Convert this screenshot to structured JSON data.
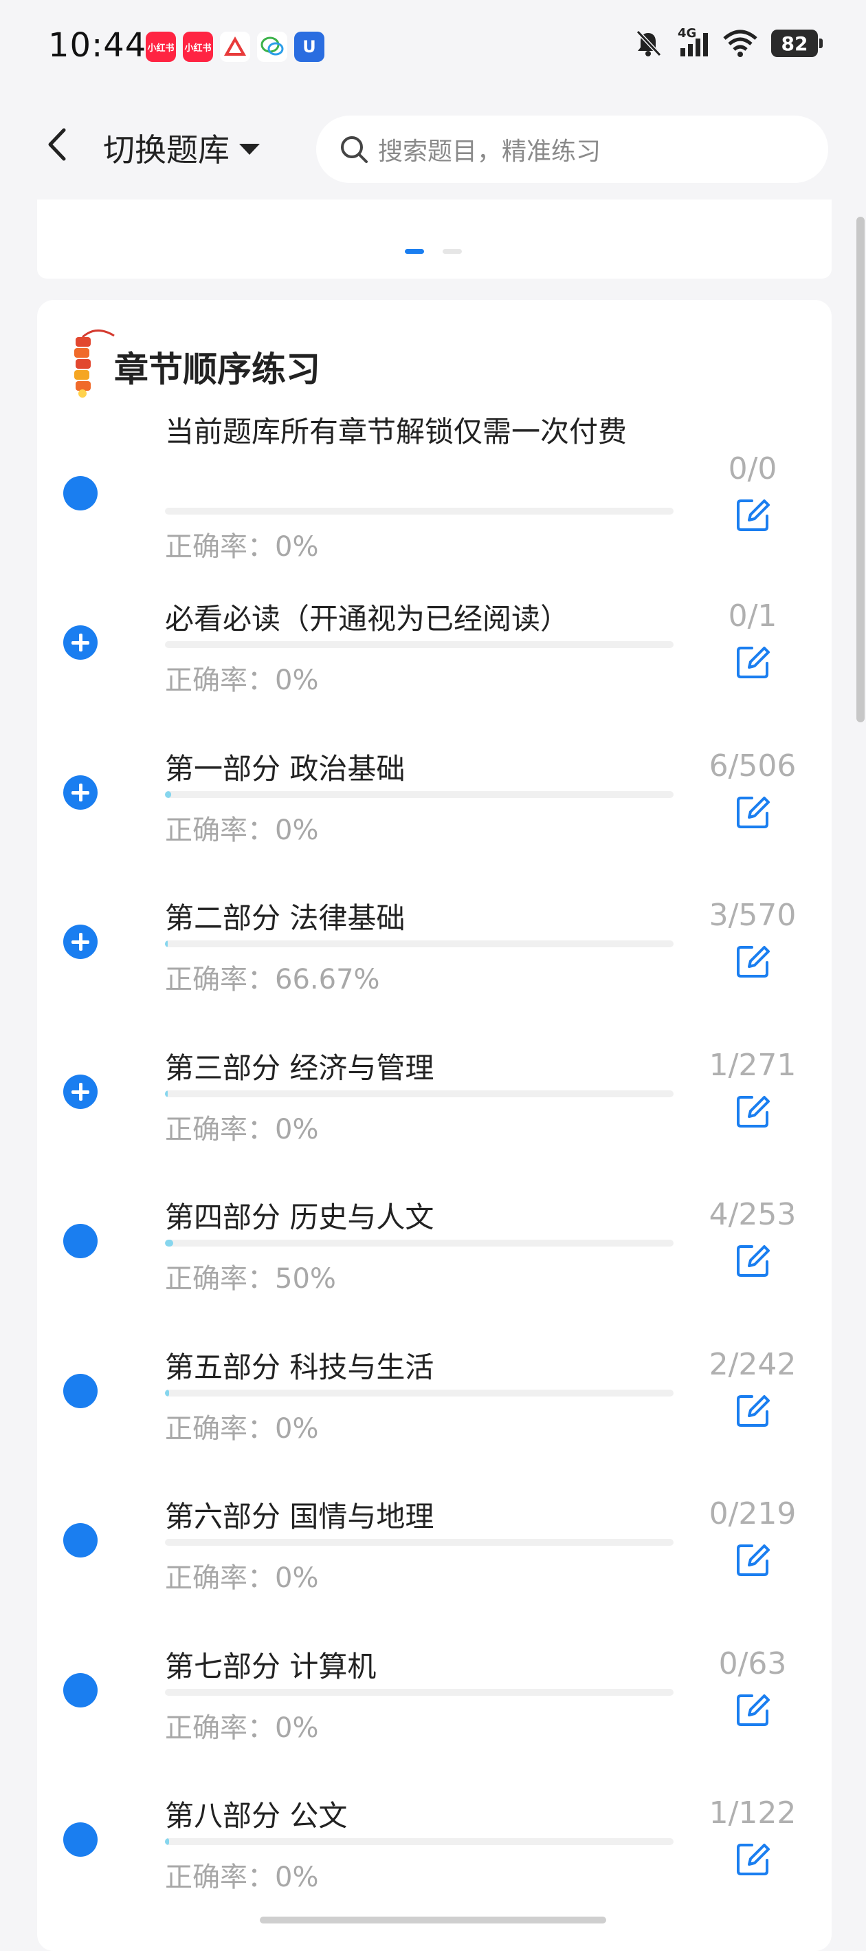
{
  "status_bar": {
    "time": "10:44",
    "battery": "82",
    "network": "4G",
    "apps": [
      {
        "label": "小红书",
        "color": "#ff2442"
      },
      {
        "label": "小红书",
        "color": "#ff2442"
      },
      {
        "label": "",
        "color": "#ffffff"
      },
      {
        "label": "",
        "color": "#ffffff"
      },
      {
        "label": "U",
        "color": "#2a6de0"
      }
    ]
  },
  "header": {
    "switch_label": "切换题库",
    "search_placeholder": "搜索题目，精准练习"
  },
  "section": {
    "title": "章节顺序练习"
  },
  "accuracy_prefix": "正确率：",
  "rows": [
    {
      "title": "当前题库所有章节解锁仅需一次付费",
      "accuracy": "0%",
      "count": "0/0",
      "icon": "dot",
      "progress": 0
    },
    {
      "title": "必看必读（开通视为已经阅读）",
      "accuracy": "0%",
      "count": "0/1",
      "icon": "plus",
      "progress": 0
    },
    {
      "title": "第一部分 政治基础",
      "accuracy": "0%",
      "count": "6/506",
      "icon": "plus",
      "progress": 0.012
    },
    {
      "title": "第二部分 法律基础",
      "accuracy": "66.67%",
      "count": "3/570",
      "icon": "plus",
      "progress": 0.005
    },
    {
      "title": "第三部分 经济与管理",
      "accuracy": "0%",
      "count": "1/271",
      "icon": "plus",
      "progress": 0.004
    },
    {
      "title": "第四部分 历史与人文",
      "accuracy": "50%",
      "count": "4/253",
      "icon": "dot",
      "progress": 0.016
    },
    {
      "title": "第五部分 科技与生活",
      "accuracy": "0%",
      "count": "2/242",
      "icon": "dot",
      "progress": 0.008
    },
    {
      "title": "第六部分 国情与地理",
      "accuracy": "0%",
      "count": "0/219",
      "icon": "dot",
      "progress": 0
    },
    {
      "title": "第七部分 计算机",
      "accuracy": "0%",
      "count": "0/63",
      "icon": "dot",
      "progress": 0
    },
    {
      "title": "第八部分 公文",
      "accuracy": "0%",
      "count": "1/122",
      "icon": "dot",
      "progress": 0.008
    }
  ],
  "colors": {
    "accent": "#1a7ef0",
    "progress_fill": "#86d6ee",
    "muted_text": "#a8a8a8"
  }
}
